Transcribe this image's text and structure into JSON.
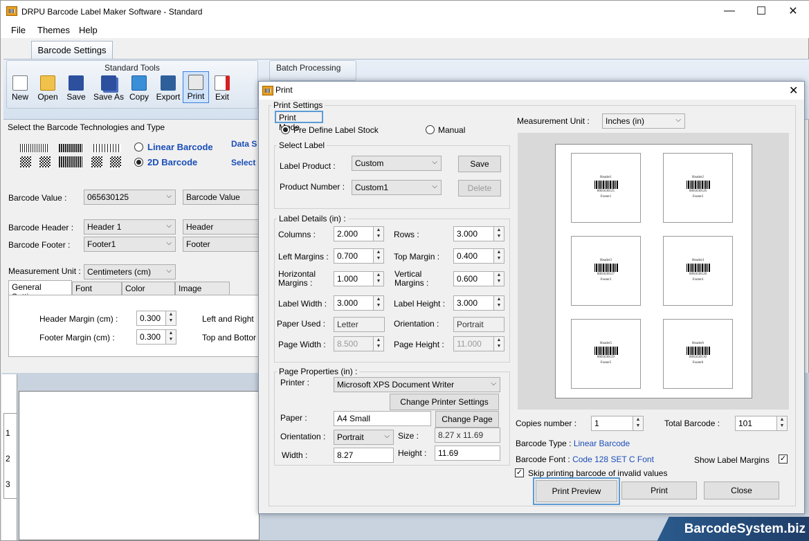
{
  "window": {
    "title": "DRPU Barcode Label Maker Software - Standard"
  },
  "menu": {
    "file": "File",
    "themes": "Themes",
    "help": "Help"
  },
  "ribbon": {
    "tab": "Barcode Settings",
    "group_standard": "Standard Tools",
    "group_batch": "Batch Processing",
    "tools": [
      "New",
      "Open",
      "Save",
      "Save As",
      "Copy",
      "Export",
      "Print",
      "Exit"
    ]
  },
  "left": {
    "tech_heading": "Select the Barcode Technologies and Type",
    "linear": "Linear Barcode",
    "twod": "2D Barcode",
    "data_s": "Data S",
    "select": "Select",
    "barcode_value_label": "Barcode Value :",
    "barcode_value": "065630125",
    "barcode_value_src": "Barcode Value",
    "header_label": "Barcode Header :",
    "header_value": "Header 1",
    "header_src": "Header",
    "footer_label": "Barcode Footer :",
    "footer_value": "Footer1",
    "footer_src": "Footer",
    "mu_label": "Measurement Unit :",
    "mu_value": "Centimeters (cm)",
    "tabs": [
      "General Settings",
      "Font Settings",
      "Color Settings",
      "Image Settings"
    ],
    "header_margin_label": "Header Margin (cm) :",
    "header_margin": "0.300",
    "footer_margin_label": "Footer Margin (cm) :",
    "footer_margin": "0.300",
    "left_right": "Left and Right",
    "top_bottom": "Top and Bottor",
    "ruler": [
      "1",
      "2",
      "3"
    ]
  },
  "dialog": {
    "title": "Print",
    "print_settings": "Print Settings",
    "print_mode": "Print Mode",
    "predefined": "Pre Define Label Stock",
    "manual": "Manual",
    "select_label": "Select Label",
    "label_product_label": "Label Product :",
    "label_product": "Custom",
    "save": "Save",
    "product_number_label": "Product Number :",
    "product_number": "Custom1",
    "delete": "Delete",
    "label_details": "Label Details (in) :",
    "columns_label": "Columns :",
    "columns": "2.000",
    "rows_label": "Rows :",
    "rows": "3.000",
    "left_margins_label": "Left Margins :",
    "left_margins": "0.700",
    "top_margin_label": "Top Margin :",
    "top_margin": "0.400",
    "h_margins_label": "Horizontal Margins :",
    "h_margins": "1.000",
    "v_margins_label": "Vertical Margins :",
    "v_margins": "0.600",
    "label_width_label": "Label Width :",
    "label_width": "3.000",
    "label_height_label": "Label Height :",
    "label_height": "3.000",
    "paper_used_label": "Paper Used :",
    "paper_used": "Letter",
    "orientation_label": "Orientation :",
    "orientation": "Portrait",
    "page_width_label": "Page Width :",
    "page_width": "8.500",
    "page_height_label": "Page Height :",
    "page_height": "11.000",
    "page_props": "Page Properties (in) :",
    "printer_label": "Printer :",
    "printer": "Microsoft XPS Document Writer",
    "change_printer": "Change Printer Settings",
    "paper_label": "Paper :",
    "paper": "A4 Small",
    "change_page": "Change Page",
    "orient2_label": "Orientation :",
    "orient2": "Portrait",
    "size_label": "Size :",
    "size": "8.27 x 11.69",
    "width_label": "Width :",
    "width": "8.27",
    "height_label": "Height :",
    "height": "11.69",
    "mu_label": "Measurement Unit :",
    "mu": "Inches (in)",
    "copies_label": "Copies number :",
    "copies": "1",
    "total_label": "Total Barcode :",
    "total": "101",
    "type_label": "Barcode Type :",
    "type": "Linear Barcode",
    "font_label": "Barcode Font :",
    "font": "Code 128 SET C Font",
    "show_margins": "Show Label Margins",
    "skip_invalid": "Skip printing barcode of invalid values",
    "print_preview": "Print Preview",
    "print": "Print",
    "close": "Close",
    "labels": [
      {
        "header": "Header1",
        "value": "8065630125",
        "footer": "Footer1"
      },
      {
        "header": "Header2",
        "value": "8065630126",
        "footer": "Footer2"
      },
      {
        "header": "Header3",
        "value": "8065630127",
        "footer": "Footer3"
      },
      {
        "header": "Header4",
        "value": "8065630128",
        "footer": "Footer4"
      },
      {
        "header": "Header5",
        "value": "8065630129",
        "footer": "Footer5"
      },
      {
        "header": "Header6",
        "value": "8065630130",
        "footer": "Footer6"
      }
    ]
  },
  "watermark": "BarcodeSystem.biz"
}
